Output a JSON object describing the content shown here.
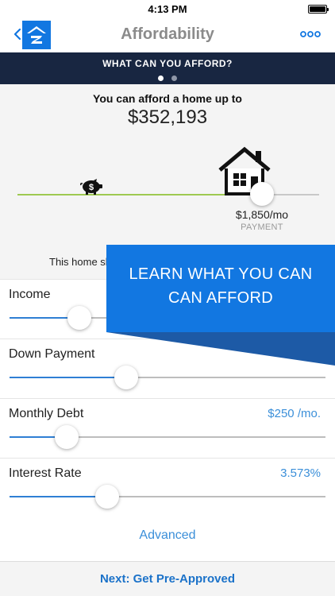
{
  "status_bar": {
    "time": "4:13 PM"
  },
  "nav": {
    "title": "Affordability",
    "back_icon": "chevron-left-icon",
    "logo_icon": "zillow-logo-icon",
    "menu_icon": "more-dots-icon"
  },
  "header_band": {
    "title": "WHAT CAN YOU AFFORD?",
    "page_count": 2,
    "active_page": 1
  },
  "hero": {
    "afford_label": "You can afford a home up to",
    "afford_value": "$352,193",
    "payment_value": "$1,850/mo",
    "payment_label": "PAYMENT",
    "note": "This home sh",
    "slider_fraction": 0.81
  },
  "promo": {
    "line1": "LEARN WHAT YOU CAN",
    "line2": "CAN AFFORD"
  },
  "fields": [
    {
      "label": "Income",
      "value": "",
      "fraction": 0.22
    },
    {
      "label": "Down Payment",
      "value": "",
      "fraction": 0.37
    },
    {
      "label": "Monthly Debt",
      "value": "$250 /mo.",
      "fraction": 0.18
    },
    {
      "label": "Interest Rate",
      "value": "3.573%",
      "fraction": 0.31
    }
  ],
  "advanced_label": "Advanced",
  "footer": {
    "next_label": "Next: Get Pre-Approved"
  },
  "colors": {
    "brand_blue": "#1277e1",
    "header_navy": "#182641",
    "accent_blue": "#3b8fd9",
    "track_green": "#9ec951"
  }
}
